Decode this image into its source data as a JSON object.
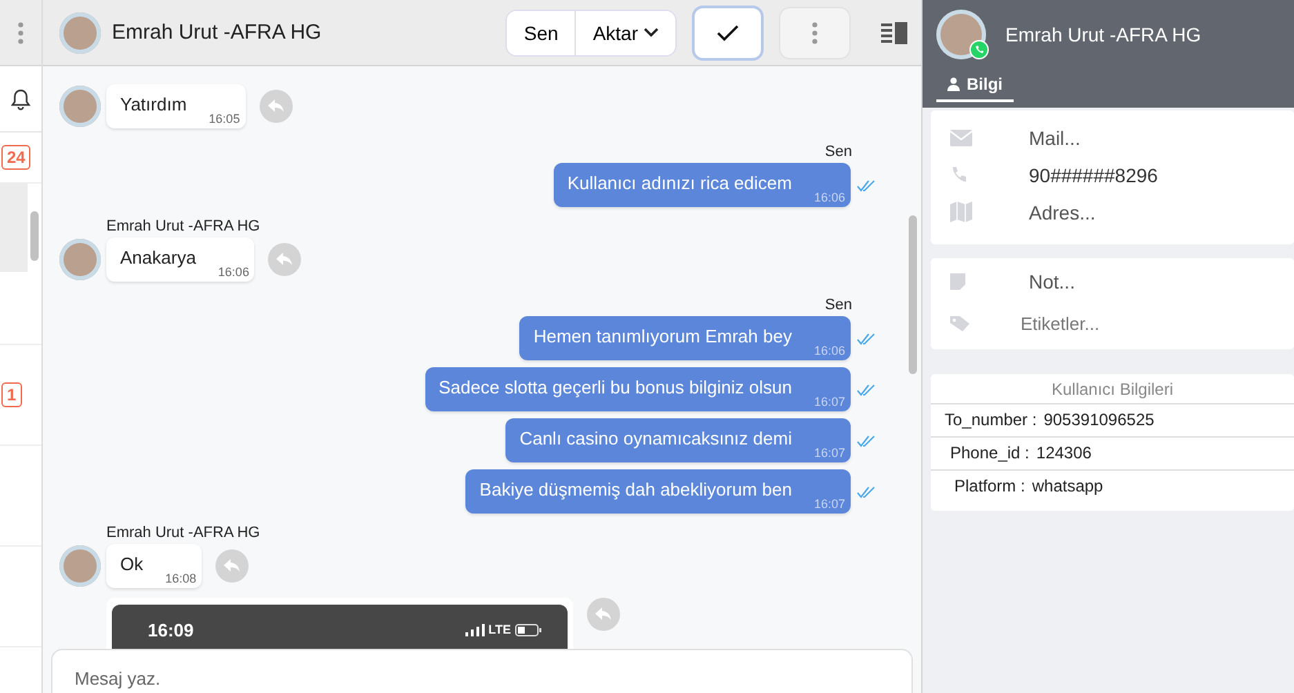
{
  "sidebar_strip": {
    "badges": [
      "24",
      "1"
    ]
  },
  "chat": {
    "title": "Emrah Urut -AFRA HG",
    "sender_toggle": "Sen",
    "transfer": "Aktar",
    "messages": [
      {
        "kind": "incoming",
        "text": "Yatırdım",
        "time": "16:05"
      },
      {
        "kind": "outgoing",
        "sender": "Sen",
        "text": "Kullanıcı adınızı rica edicem",
        "time": "16:06"
      },
      {
        "kind": "incoming",
        "sender": "Emrah Urut -AFRA HG",
        "text": "Anakarya",
        "time": "16:06"
      },
      {
        "kind": "outgoing",
        "sender": "Sen",
        "text": "Hemen tanımlıyorum Emrah bey",
        "time": "16:06"
      },
      {
        "kind": "outgoing",
        "text": "Sadece slotta geçerli bu bonus bilginiz olsun",
        "time": "16:07"
      },
      {
        "kind": "outgoing",
        "text": "Canlı casino oynamıcaksınız demi",
        "time": "16:07"
      },
      {
        "kind": "outgoing",
        "text": "Bakiye düşmemiş dah abekliyorum ben",
        "time": "16:07"
      },
      {
        "kind": "incoming",
        "sender": "Emrah Urut -AFRA HG",
        "text": "Ok",
        "time": "16:08"
      },
      {
        "kind": "image",
        "image_time": "16:09",
        "network": "LTE"
      }
    ]
  },
  "composer": {
    "placeholder": "Mesaj yaz."
  },
  "contact_panel": {
    "name": "Emrah Urut -AFRA HG",
    "tabs": [
      {
        "label": "Bilgi",
        "selected": true
      }
    ],
    "contact_fields": [
      {
        "kind": "mail",
        "placeholder": "Mail..."
      },
      {
        "kind": "phone",
        "value": "90######8296"
      },
      {
        "kind": "address",
        "placeholder": "Adres..."
      }
    ],
    "note_fields": [
      {
        "kind": "note",
        "placeholder": "Not..."
      },
      {
        "kind": "tags",
        "placeholder": "Etiketler..."
      }
    ],
    "user_info": {
      "title": "Kullanıcı Bilgileri",
      "rows": [
        {
          "label": "To_number :",
          "value": "905391096525"
        },
        {
          "label": "Phone_id :",
          "value": "124306"
        },
        {
          "label": "Platform :",
          "value": "whatsapp"
        }
      ]
    }
  }
}
